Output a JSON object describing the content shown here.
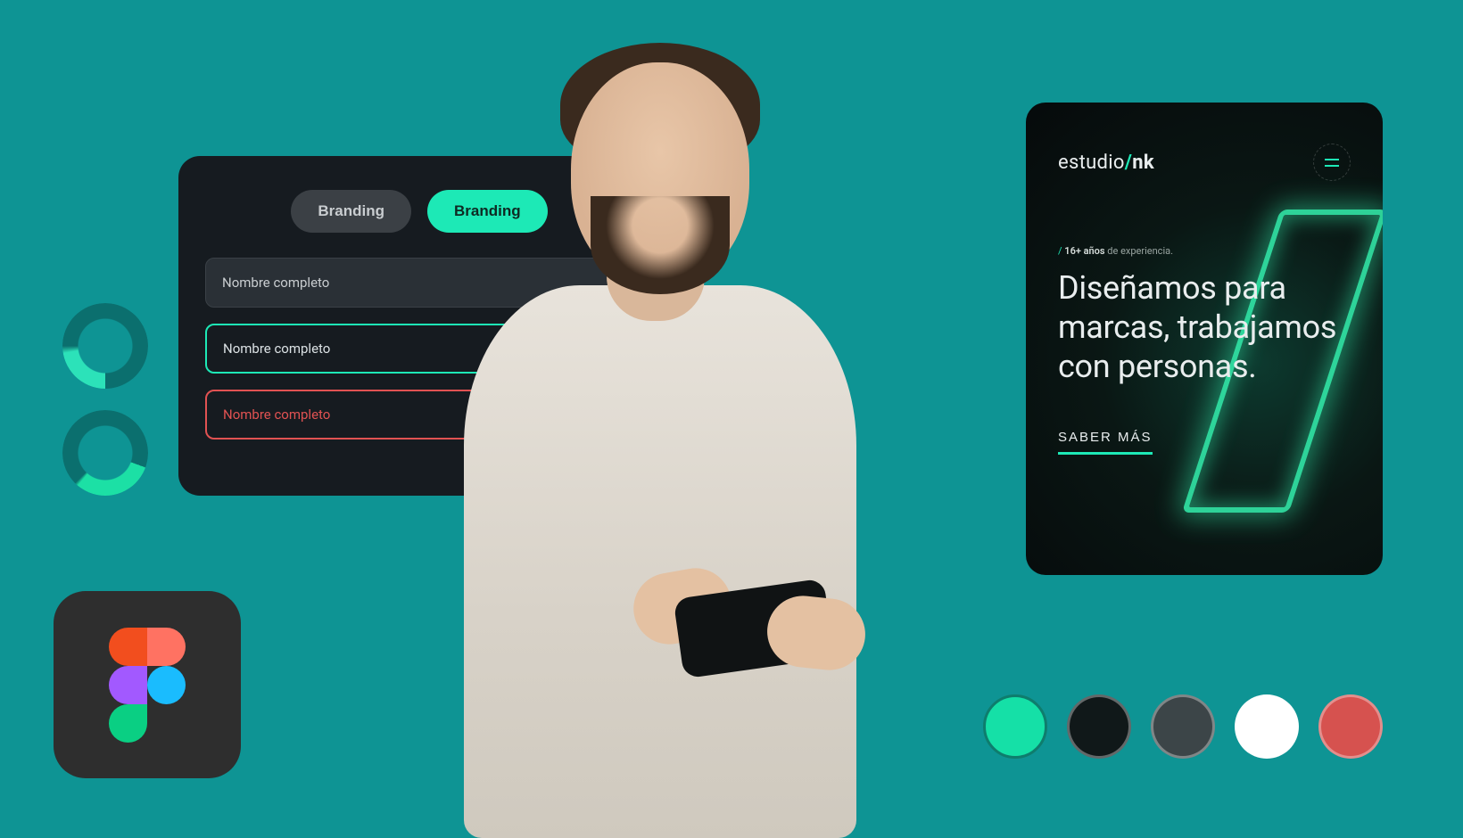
{
  "ui_card": {
    "chips": {
      "inactive": "Branding",
      "active": "Branding"
    },
    "fields": {
      "default": "Nombre completo",
      "focus": "Nombre completo",
      "error": "Nombre completo"
    }
  },
  "mobile": {
    "brand_prefix": "estudio",
    "brand_slash": "/",
    "brand_suffix": "nk",
    "tagline_slash": "/",
    "tagline_bold": "16+ años",
    "tagline_rest": " de experiencia.",
    "headline": "Diseñamos para marcas, trabajamos con personas.",
    "cta": "SABER MÁS",
    "menu_icon": "menu-icon"
  },
  "palette": {
    "colors": [
      "#15e0a7",
      "#101819",
      "#3c4548",
      "#ffffff",
      "#d6524f"
    ]
  },
  "apps": {
    "figma": "figma-logo"
  }
}
